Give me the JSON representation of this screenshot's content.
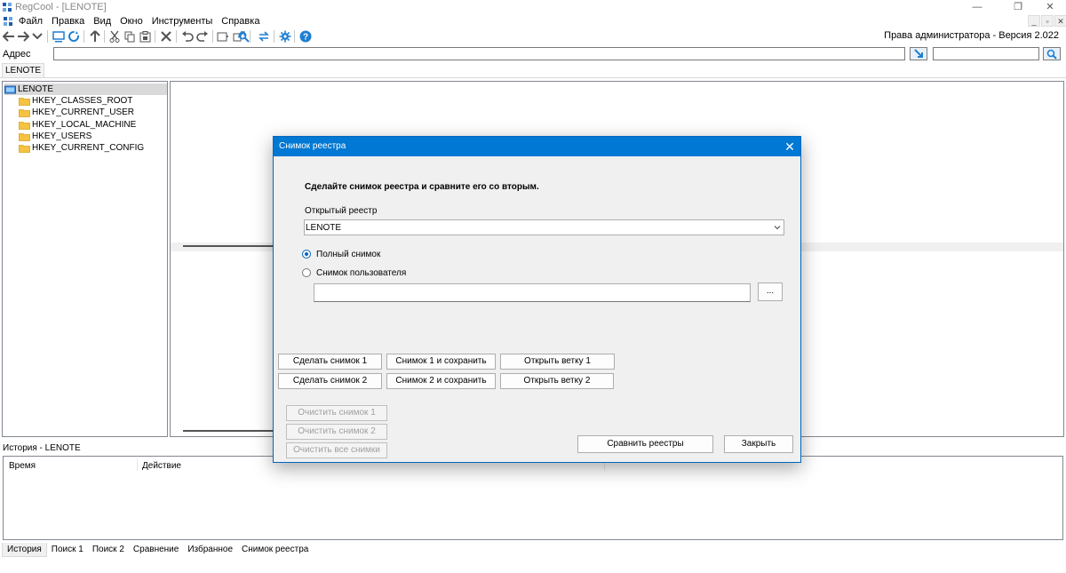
{
  "window": {
    "title": "RegCool - [LENOTE]",
    "controls": [
      "—",
      "❐",
      "✕"
    ]
  },
  "menubar": {
    "items": [
      "Файл",
      "Правка",
      "Вид",
      "Окно",
      "Инструменты",
      "Справка"
    ],
    "mdi_controls": [
      "_",
      "▫",
      "✕"
    ]
  },
  "toolbar": {
    "admin_version": "Права администратора - Версия 2.022"
  },
  "address": {
    "label": "Адрес",
    "value": "",
    "search_value": ""
  },
  "doc_tab": "LENOTE",
  "tree": {
    "root": "LENOTE",
    "children": [
      "HKEY_CLASSES_ROOT",
      "HKEY_CURRENT_USER",
      "HKEY_LOCAL_MACHINE",
      "HKEY_USERS",
      "HKEY_CURRENT_CONFIG"
    ]
  },
  "history": {
    "title": "История - LENOTE",
    "columns": [
      "Время",
      "Действие"
    ]
  },
  "bottom_tabs": [
    "История",
    "Поиск 1",
    "Поиск 2",
    "Сравнение",
    "Избранное",
    "Снимок реестра"
  ],
  "dialog": {
    "title": "Снимок реестра",
    "close_glyph": "✕",
    "heading": "Сделайте снимок реестра и сравните его со вторым.",
    "registry_label": "Открытый реестр",
    "registry_selected": "LENOTE",
    "radio_full": "Полный снимок",
    "radio_user": "Снимок пользователя",
    "path_value": "",
    "browse_label": "...",
    "buttons": {
      "snap1": "Сделать снимок 1",
      "snap1_save": "Снимок 1 и сохранить",
      "open_branch1": "Открыть ветку 1",
      "snap2": "Сделать снимок 2",
      "snap2_save": "Снимок 2 и сохранить",
      "open_branch2": "Открыть ветку 2",
      "clear1": "Очистить снимок 1",
      "clear2": "Очистить снимок 2",
      "clear_all": "Очистить все снимки",
      "compare": "Сравнить реестры",
      "close": "Закрыть"
    }
  },
  "colors": {
    "accent": "#0078d4",
    "folder": "#f5c342",
    "toolbar_blue": "#1e7fd1",
    "selection": "#d9d9d9"
  }
}
